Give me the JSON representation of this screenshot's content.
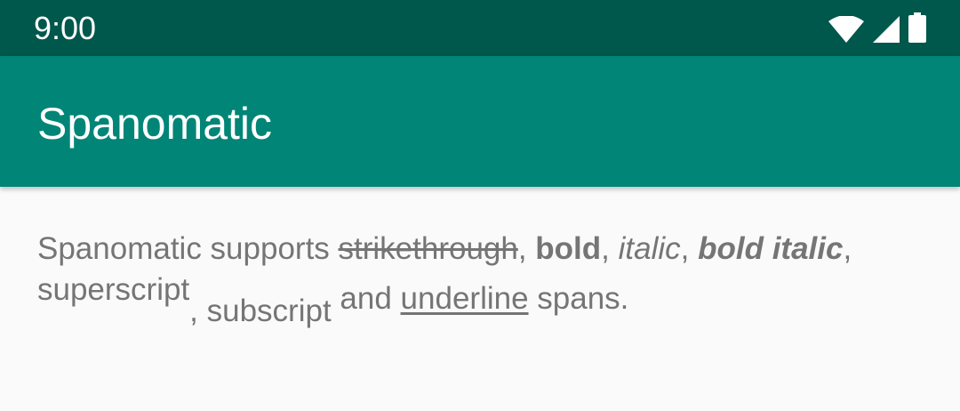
{
  "status_bar": {
    "time": "9:00",
    "icons": [
      "wifi-icon",
      "cellular-signal-icon",
      "battery-icon"
    ]
  },
  "app_bar": {
    "title": "Spanomatic"
  },
  "content": {
    "intro": "Spanomatic supports ",
    "strikethrough": "strikethrough",
    "sep1": ", ",
    "bold": "bold",
    "sep2": ", ",
    "italic": "italic",
    "sep3": ", ",
    "bold_italic": "bold italic",
    "sep4": ", ",
    "superscript": "superscript",
    "sep5": ", ",
    "subscript": "subscript",
    "and_text": " and ",
    "underline": "underline",
    "outro": " spans."
  },
  "colors": {
    "status_bar": "#00574b",
    "app_bar": "#008577",
    "background": "#fafafa",
    "body_text": "#757575"
  }
}
